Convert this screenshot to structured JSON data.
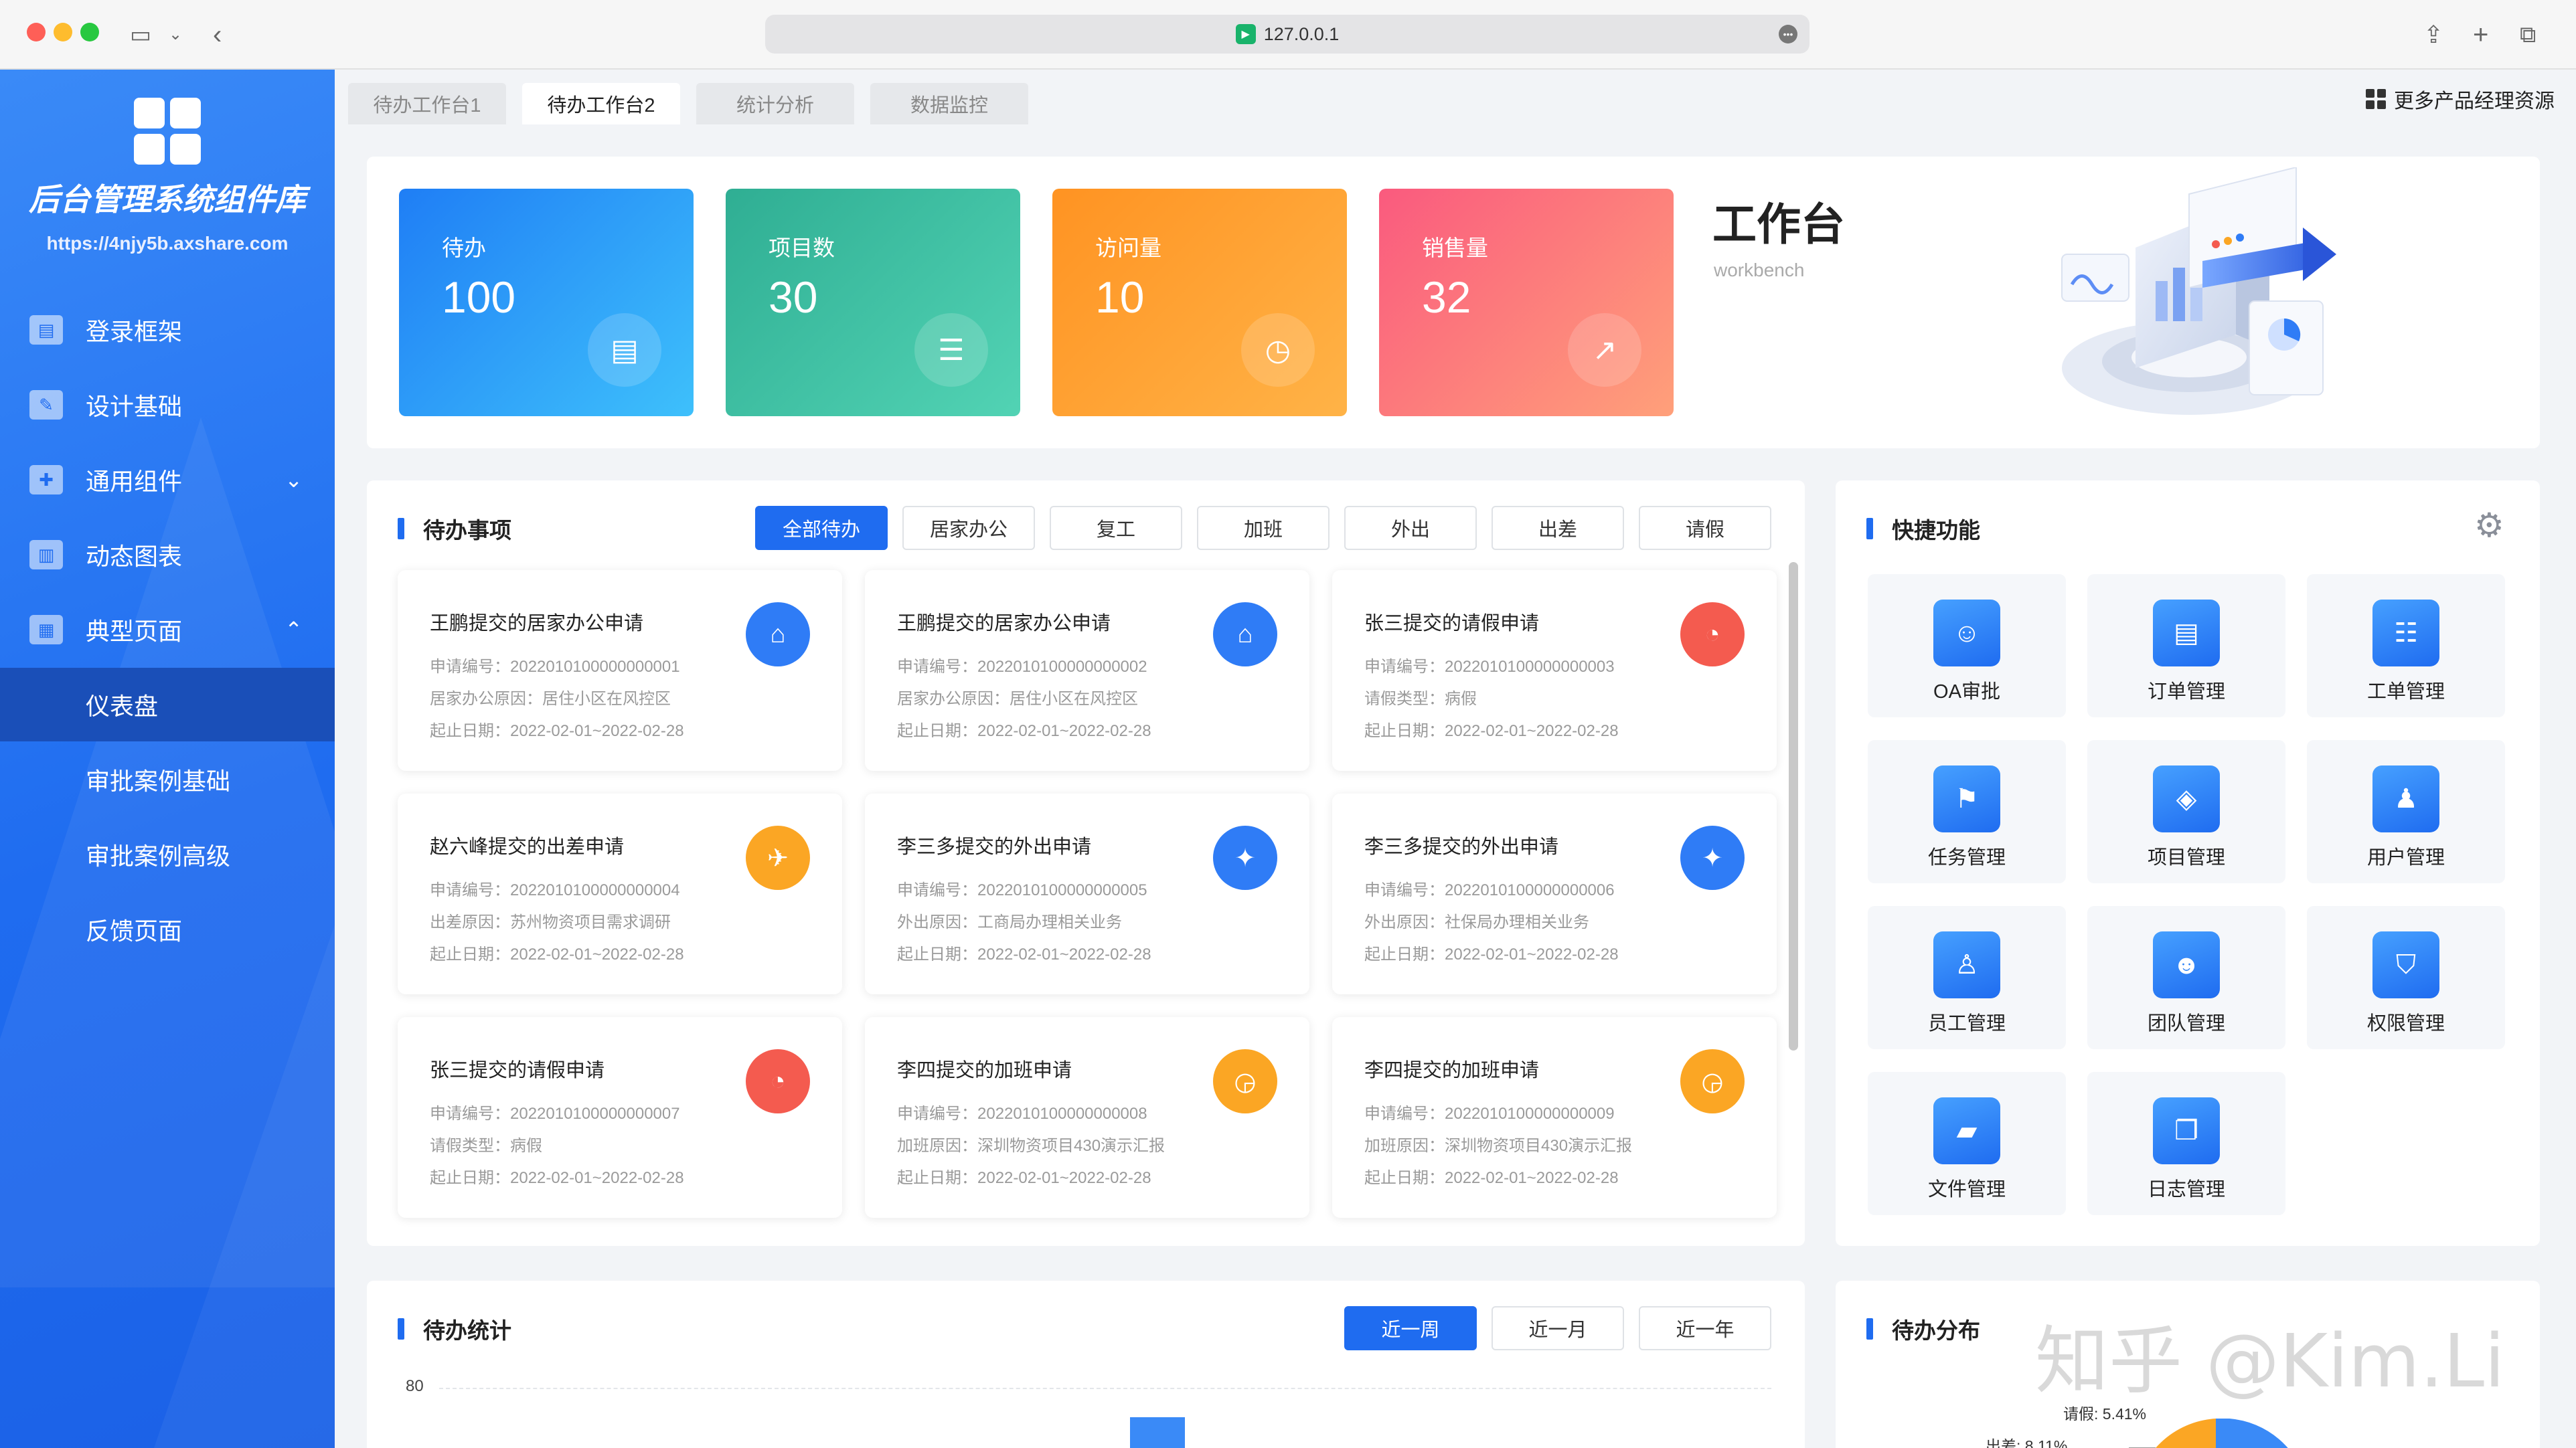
{
  "browser": {
    "url": "127.0.0.1"
  },
  "sidebar": {
    "brand": "后台管理系统组件库",
    "url": "https://4njy5b.axshare.com",
    "menu": [
      {
        "label": "登录框架",
        "icon": "layout-icon"
      },
      {
        "label": "设计基础",
        "icon": "brush-icon"
      },
      {
        "label": "通用组件",
        "icon": "puzzle-icon",
        "expanded": false
      },
      {
        "label": "动态图表",
        "icon": "chart-icon"
      },
      {
        "label": "典型页面",
        "icon": "page-icon",
        "expanded": true
      }
    ],
    "submenu": [
      {
        "label": "仪表盘",
        "active": true
      },
      {
        "label": "审批案例基础"
      },
      {
        "label": "审批案例高级"
      },
      {
        "label": "反馈页面"
      }
    ]
  },
  "tabs": [
    {
      "label": "待办工作台1"
    },
    {
      "label": "待办工作台2",
      "active": true
    },
    {
      "label": "统计分析"
    },
    {
      "label": "数据监控"
    }
  ],
  "more_resources": "更多产品经理资源",
  "stats": [
    {
      "label": "待办",
      "value": "100",
      "color": "#2f8ef8",
      "icon": "calendar-clock-icon"
    },
    {
      "label": "项目数",
      "value": "30",
      "color": "#3bbfa0",
      "icon": "list-doc-icon"
    },
    {
      "label": "访问量",
      "value": "10",
      "color": "#ff9b2e",
      "icon": "clock-icon"
    },
    {
      "label": "销售量",
      "value": "32",
      "color": "#fb6f78",
      "icon": "trend-icon"
    }
  ],
  "workbench": {
    "title": "工作台",
    "subtitle": "workbench"
  },
  "todo": {
    "title": "待办事项",
    "filters": [
      "全部待办",
      "居家办公",
      "复工",
      "加班",
      "外出",
      "出差",
      "请假"
    ],
    "active_filter": "全部待办",
    "cards": [
      {
        "title": "王鹏提交的居家办公申请",
        "lines": [
          "申请编号：2022010100000000001",
          "居家办公原因：居住小区在风控区",
          "起止日期：2022-02-01~2022-02-28"
        ],
        "icon": "home-icon",
        "color": "#2f7cf6"
      },
      {
        "title": "王鹏提交的居家办公申请",
        "lines": [
          "申请编号：2022010100000000002",
          "居家办公原因：居住小区在风控区",
          "起止日期：2022-02-01~2022-02-28"
        ],
        "icon": "home-icon",
        "color": "#2f7cf6"
      },
      {
        "title": "张三提交的请假申请",
        "lines": [
          "申请编号：2022010100000000003",
          "请假类型：病假",
          "起止日期：2022-02-01~2022-02-28"
        ],
        "icon": "person-clock-icon",
        "color": "#f45b4f"
      },
      {
        "title": "赵六峰提交的出差申请",
        "lines": [
          "申请编号：2022010100000000004",
          "出差原因：苏州物资项目需求调研",
          "起止日期：2022-02-01~2022-02-28"
        ],
        "icon": "plane-icon",
        "color": "#fba624"
      },
      {
        "title": "李三多提交的外出申请",
        "lines": [
          "申请编号：2022010100000000005",
          "外出原因：工商局办理相关业务",
          "起止日期：2022-02-01~2022-02-28"
        ],
        "icon": "walk-icon",
        "color": "#2f7cf6"
      },
      {
        "title": "李三多提交的外出申请",
        "lines": [
          "申请编号：2022010100000000006",
          "外出原因：社保局办理相关业务",
          "起止日期：2022-02-01~2022-02-28"
        ],
        "icon": "walk-icon",
        "color": "#2f7cf6"
      },
      {
        "title": "张三提交的请假申请",
        "lines": [
          "申请编号：2022010100000000007",
          "请假类型：病假",
          "起止日期：2022-02-01~2022-02-28"
        ],
        "icon": "person-clock-icon",
        "color": "#f45b4f"
      },
      {
        "title": "李四提交的加班申请",
        "lines": [
          "申请编号：2022010100000000008",
          "加班原因：深圳物资项目430演示汇报",
          "起止日期：2022-02-01~2022-02-28"
        ],
        "icon": "overtime-icon",
        "color": "#fba624"
      },
      {
        "title": "李四提交的加班申请",
        "lines": [
          "申请编号：2022010100000000009",
          "加班原因：深圳物资项目430演示汇报",
          "起止日期：2022-02-01~2022-02-28"
        ],
        "icon": "overtime-icon",
        "color": "#fba624"
      }
    ]
  },
  "quick": {
    "title": "快捷功能",
    "items": [
      {
        "label": "OA审批",
        "icon": "user-badge-icon"
      },
      {
        "label": "订单管理",
        "icon": "order-icon"
      },
      {
        "label": "工单管理",
        "icon": "clipboard-icon"
      },
      {
        "label": "任务管理",
        "icon": "flag-icon"
      },
      {
        "label": "项目管理",
        "icon": "layers-icon"
      },
      {
        "label": "用户管理",
        "icon": "users-icon"
      },
      {
        "label": "员工管理",
        "icon": "employee-icon"
      },
      {
        "label": "团队管理",
        "icon": "team-icon"
      },
      {
        "label": "权限管理",
        "icon": "shield-icon"
      },
      {
        "label": "文件管理",
        "icon": "folder-icon"
      },
      {
        "label": "日志管理",
        "icon": "log-icon"
      }
    ]
  },
  "todo_stats": {
    "title": "待办统计",
    "ranges": [
      "近一周",
      "近一月",
      "近一年"
    ],
    "active_range": "近一周",
    "chart_data": {
      "type": "bar",
      "y_tick_visible": 80
    }
  },
  "todo_distribution": {
    "title": "待办分布",
    "chart_data": {
      "type": "pie",
      "slices": [
        {
          "name": "请假",
          "label": "请假: 5.41%",
          "value": 5.41
        },
        {
          "name": "出差",
          "label": "出差: 8.11%",
          "value": 8.11
        }
      ]
    }
  },
  "watermark": "知乎 @Kim.Li"
}
